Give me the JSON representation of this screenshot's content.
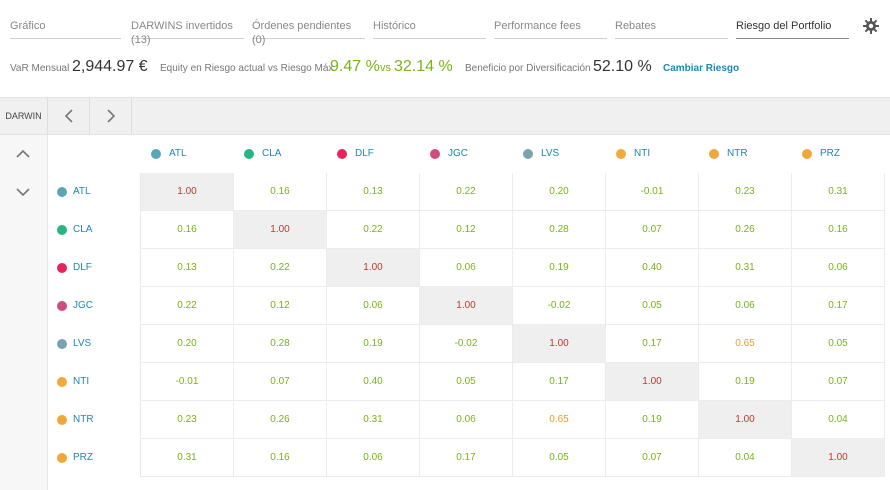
{
  "tabs": [
    {
      "label": "Gráfico",
      "active": false
    },
    {
      "label": "DARWINS invertidos (13)",
      "active": false
    },
    {
      "label": "Órdenes pendientes (0)",
      "active": false
    },
    {
      "label": "Histórico",
      "active": false
    },
    {
      "label": "Performance fees",
      "active": false
    },
    {
      "label": "Rebates",
      "active": false
    },
    {
      "label": "Riesgo del Portfolio",
      "active": true
    }
  ],
  "settings_icon": "gear-icon",
  "stats": {
    "var_label": "VaR Mensual",
    "var_value": "2,944.97 €",
    "equity_label": "Equity en Riesgo actual vs Riesgo Máx.",
    "equity_current": "9.47 %",
    "vs": "vs",
    "equity_max": "32.14 %",
    "div_label": "Beneficio por Diversificación",
    "div_value": "52.10 %",
    "change_risk": "Cambiar Riesgo"
  },
  "toolbar": {
    "darwin_label": "DARWIN",
    "prev_icon": "chevron-left-icon",
    "next_icon": "chevron-right-icon",
    "up_icon": "chevron-up-icon",
    "down_icon": "chevron-down-icon"
  },
  "colors": {
    "accent": "#1e87b4",
    "positive": "#7ab317",
    "warning": "#e6a020",
    "danger": "#c0392b"
  },
  "darwins": [
    {
      "name": "ATL",
      "color": "#5aa7b7"
    },
    {
      "name": "CLA",
      "color": "#27b682"
    },
    {
      "name": "DLF",
      "color": "#e8245a"
    },
    {
      "name": "JGC",
      "color": "#cf4d7d"
    },
    {
      "name": "LVS",
      "color": "#79a3ad"
    },
    {
      "name": "NTI",
      "color": "#f1a93e"
    },
    {
      "name": "NTR",
      "color": "#f0a83d"
    },
    {
      "name": "PRZ",
      "color": "#efa838"
    }
  ],
  "correlations": [
    [
      "1.00",
      "0.16",
      "0.13",
      "0.22",
      "0.20",
      "-0.01",
      "0.23",
      "0.31"
    ],
    [
      "0.16",
      "1.00",
      "0.22",
      "0.12",
      "0.28",
      "0.07",
      "0.26",
      "0.16"
    ],
    [
      "0.13",
      "0.22",
      "1.00",
      "0.06",
      "0.19",
      "0.40",
      "0.31",
      "0.06"
    ],
    [
      "0.22",
      "0.12",
      "0.06",
      "1.00",
      "-0.02",
      "0.05",
      "0.06",
      "0.17"
    ],
    [
      "0.20",
      "0.28",
      "0.19",
      "-0.02",
      "1.00",
      "0.17",
      "0.65",
      "0.05"
    ],
    [
      "-0.01",
      "0.07",
      "0.40",
      "0.05",
      "0.17",
      "1.00",
      "0.19",
      "0.07"
    ],
    [
      "0.23",
      "0.26",
      "0.31",
      "0.06",
      "0.65",
      "0.19",
      "1.00",
      "0.04"
    ],
    [
      "0.31",
      "0.16",
      "0.06",
      "0.17",
      "0.05",
      "0.07",
      "0.04",
      "1.00"
    ]
  ]
}
